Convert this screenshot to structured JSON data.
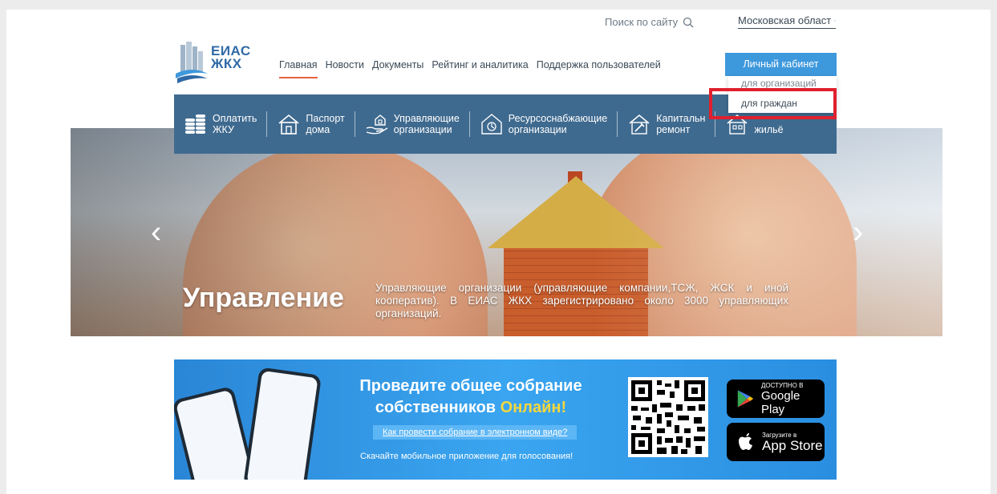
{
  "topbar": {
    "search_label": "Поиск по сайту",
    "region_label": "Московская област"
  },
  "logo": {
    "line1": "ЕИАС",
    "line2": "ЖКХ"
  },
  "nav": [
    {
      "label": "Главная",
      "active": true
    },
    {
      "label": "Новости"
    },
    {
      "label": "Документы"
    },
    {
      "label": "Рейтинг и аналитика"
    },
    {
      "label": "Поддержка пользователей"
    }
  ],
  "cabinet": {
    "button_label": "Личный кабинет",
    "options": [
      "для организаций",
      "для граждан"
    ]
  },
  "categories": [
    {
      "line1": "Оплатить",
      "line2": "ЖКУ",
      "icon": "coins-icon"
    },
    {
      "line1": "Паспорт",
      "line2": "дома",
      "icon": "house-icon"
    },
    {
      "line1": "Управляющие",
      "line2": "организации",
      "icon": "hand-house-icon"
    },
    {
      "line1": "Ресурсоснабжающие",
      "line2": "организации",
      "icon": "resource-icon"
    },
    {
      "line1": "Капитальн",
      "line2": "ремонт",
      "icon": "repair-icon"
    },
    {
      "line1": "",
      "line2": "жильё",
      "icon": "housing-icon"
    }
  ],
  "hero": {
    "title": "Управление",
    "text": "Управляющие организации (управляющие компании,ТСЖ, ЖСК и иной кооператив). В ЕИАС ЖКХ зарегистрировано около 3000 управляющих организаций.",
    "prev": "‹",
    "next": "›"
  },
  "banner": {
    "title_line1": "Проведите общее собрание",
    "title_line2_a": "собственников ",
    "title_line2_b": "Онлайн!",
    "link": "Как провести собрание в электронном виде?",
    "subtitle": "Скачайте мобильное приложение для голосования!",
    "google_small": "ДОСТУПНО В",
    "google_big": "Google Play",
    "apple_small": "Загрузите в",
    "apple_big": "App Store"
  },
  "colors": {
    "accent": "#3e98dc",
    "category_bar": "#3f6a8f",
    "highlight": "#e0202d",
    "nav_active": "#e7623b"
  }
}
